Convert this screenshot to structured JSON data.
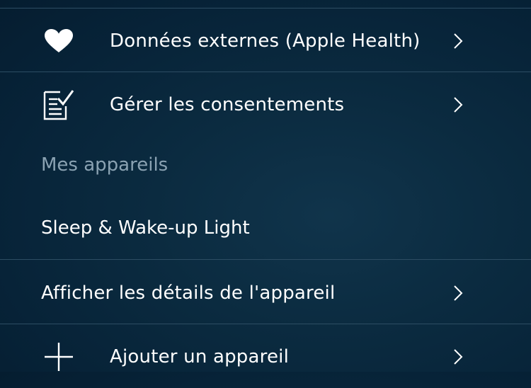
{
  "menu": {
    "apple_health": {
      "label": "Données externes (Apple Health)",
      "icon": "heart-icon"
    },
    "consents": {
      "label": "Gérer les consentements",
      "icon": "document-checklist-icon"
    }
  },
  "devices_section": {
    "header": "Mes appareils",
    "device_name": "Sleep & Wake-up Light",
    "details_label": "Afficher les détails de l'appareil",
    "add_label": "Ajouter un appareil",
    "add_icon": "plus-icon"
  },
  "colors": {
    "background": "#0b2b40",
    "divider": "#2d4d63",
    "text": "#ffffff",
    "section_header": "#8aa2b2"
  }
}
